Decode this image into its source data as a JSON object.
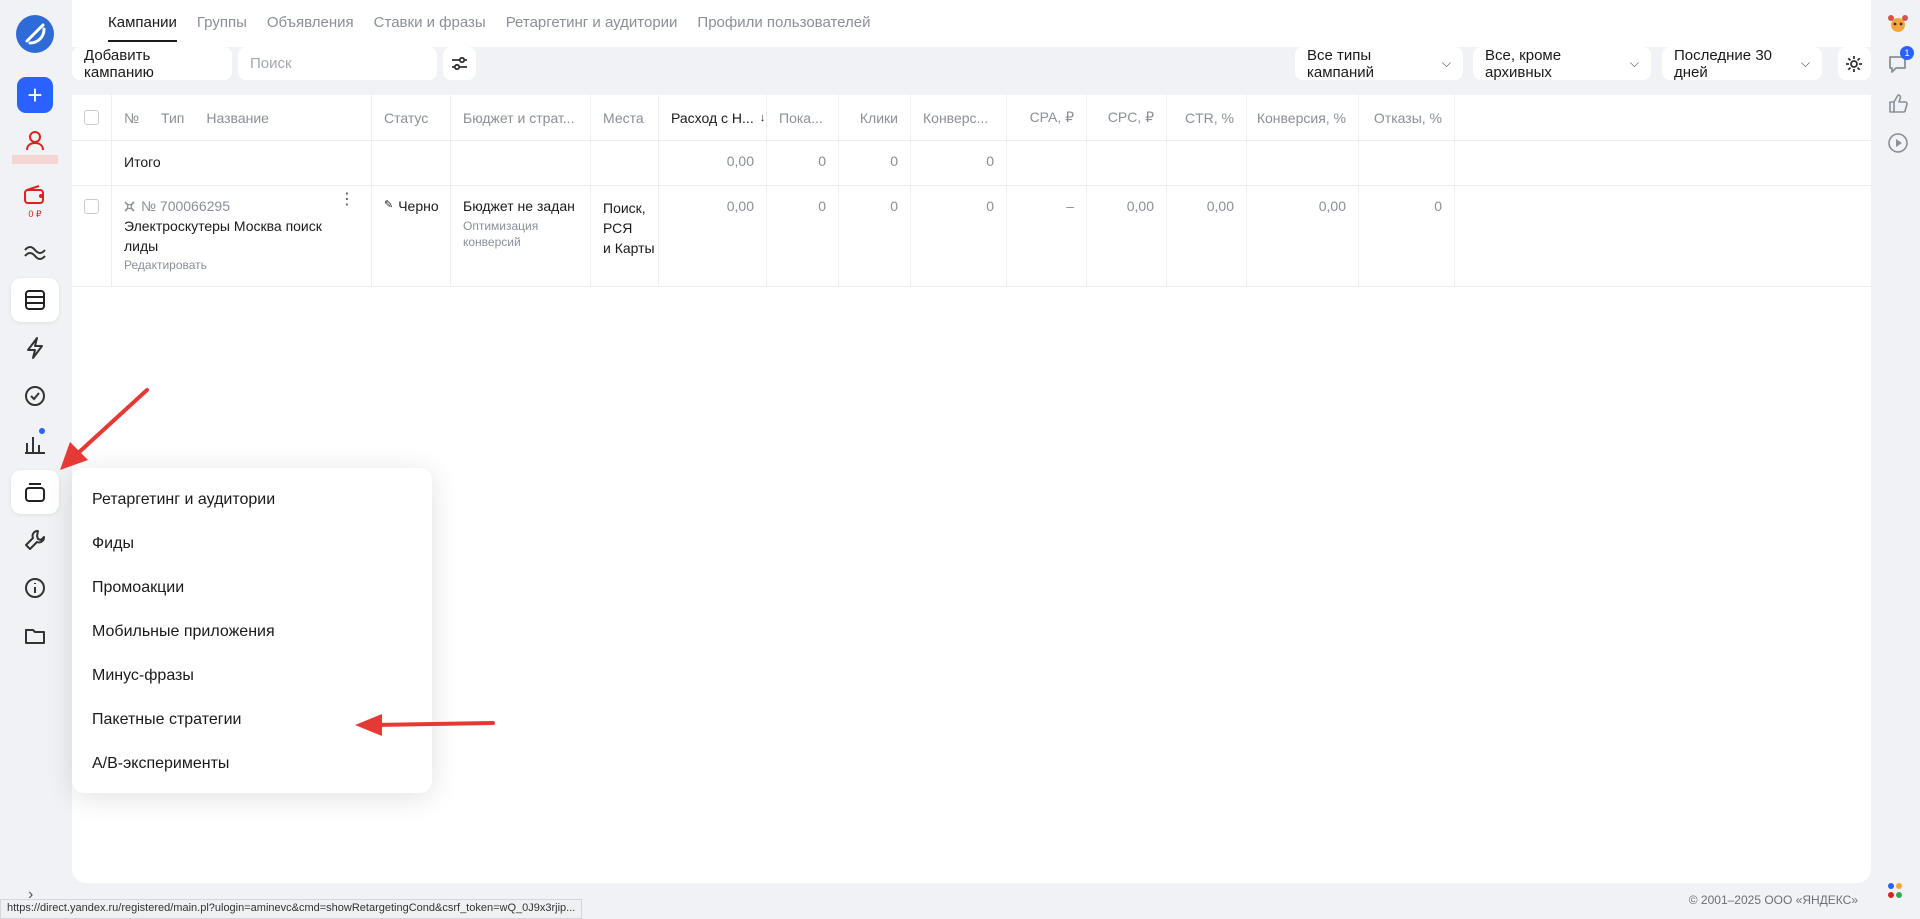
{
  "tabs": [
    {
      "label": "Кампании"
    },
    {
      "label": "Группы"
    },
    {
      "label": "Объявления"
    },
    {
      "label": "Ставки и фразы"
    },
    {
      "label": "Ретаргетинг и аудитории"
    },
    {
      "label": "Профили пользователей"
    }
  ],
  "toolbar": {
    "add_campaign": "Добавить кампанию",
    "search_placeholder": "Поиск",
    "filter_types": "Все типы кампаний",
    "filter_archive": "Все, кроме архивных",
    "filter_period": "Последние 30 дней"
  },
  "sidebar": {
    "balance": "0 ₽"
  },
  "table": {
    "headers": {
      "num": "№",
      "type": "Тип",
      "name": "Название",
      "status": "Статус",
      "budget": "Бюджет и страт...",
      "places": "Места",
      "spend": "Расход с Н...",
      "impressions": "Пока...",
      "clicks": "Клики",
      "conversions": "Конверс...",
      "cpa": "CPA, ₽",
      "cpc": "CPC, ₽",
      "ctr": "CTR, %",
      "conv_rate": "Конверсия, %",
      "bounces": "Отказы, %"
    },
    "sort_arrow": "↓",
    "total": {
      "label": "Итого",
      "spend": "0,00",
      "impressions": "0",
      "clicks": "0",
      "conversions": "0"
    },
    "campaign": {
      "id": "№ 700066295",
      "name": "Электроскутеры Москва поиск лиды",
      "edit": "Редактировать",
      "status": "Черно",
      "budget": "Бюджет не задан",
      "strategy": "Оптимизация конверсий",
      "places": [
        "Поиск,",
        "РСЯ",
        "и Карты"
      ],
      "spend": "0,00",
      "impressions": "0",
      "clicks": "0",
      "conversions": "0",
      "cpa": "–",
      "cpc": "0,00",
      "ctr": "0,00",
      "conv_rate": "0,00",
      "bounces": "0"
    }
  },
  "menu": {
    "items": [
      "Ретаргетинг и аудитории",
      "Фиды",
      "Промоакции",
      "Мобильные приложения",
      "Минус-фразы",
      "Пакетные стратегии",
      "A/B-эксперименты"
    ]
  },
  "right_rail": {
    "chat_badge": "1"
  },
  "footer": {
    "copyright": "© 2001–2025 ООО «ЯНДЕКС»"
  },
  "status_url": "https://direct.yandex.ru/registered/main.pl?ulogin=aminevc&cmd=showRetargetingCond&csrf_token=wQ_0J9x3rjip...",
  "colors": {
    "accent": "#2962ff",
    "danger": "#e02020",
    "arrow": "#e53935"
  }
}
